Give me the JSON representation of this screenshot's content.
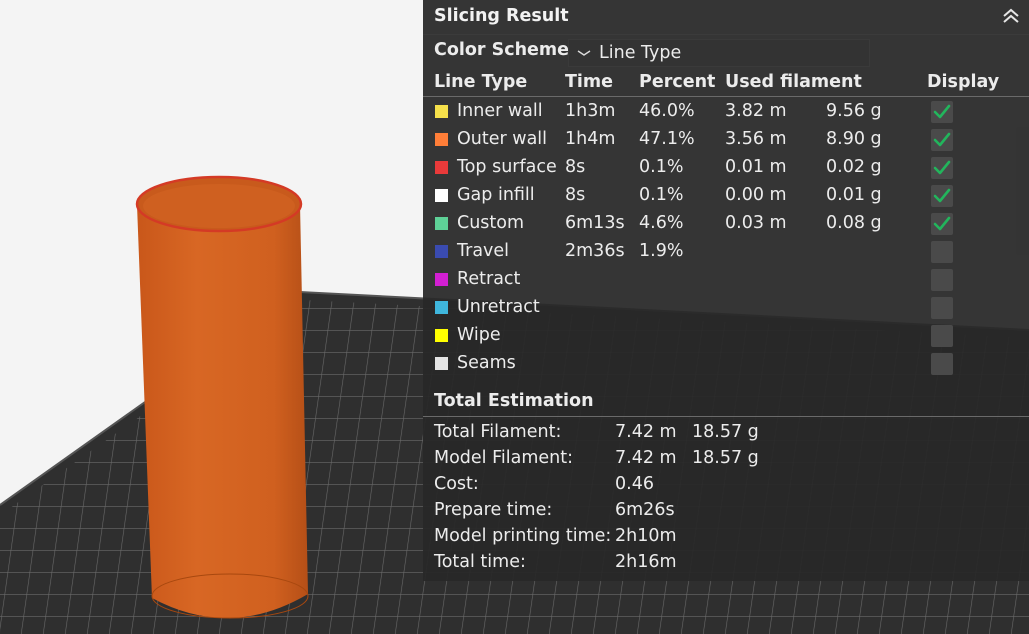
{
  "panel": {
    "title": "Slicing Result",
    "color_scheme_label": "Color Scheme",
    "color_scheme_value": "Line Type",
    "headers": {
      "line_type": "Line Type",
      "time": "Time",
      "percent": "Percent",
      "used_filament": "Used filament",
      "display": "Display"
    },
    "rows": [
      {
        "name": "Inner wall",
        "color": "#f6e14b",
        "time": "1h3m",
        "percent": "46.0%",
        "length": "3.82 m",
        "weight": "9.56 g",
        "display": true
      },
      {
        "name": "Outer wall",
        "color": "#ff7e38",
        "time": "1h4m",
        "percent": "47.1%",
        "length": "3.56 m",
        "weight": "8.90 g",
        "display": true
      },
      {
        "name": "Top surface",
        "color": "#e93a3a",
        "time": "8s",
        "percent": "0.1%",
        "length": "0.01 m",
        "weight": "0.02 g",
        "display": true
      },
      {
        "name": "Gap infill",
        "color": "#ffffff",
        "time": "8s",
        "percent": "0.1%",
        "length": "0.00 m",
        "weight": "0.01 g",
        "display": true
      },
      {
        "name": "Custom",
        "color": "#5ed197",
        "time": "6m13s",
        "percent": "4.6%",
        "length": "0.03 m",
        "weight": "0.08 g",
        "display": true
      },
      {
        "name": "Travel",
        "color": "#3a4bb0",
        "time": "2m36s",
        "percent": "1.9%",
        "length": "",
        "weight": "",
        "display": false
      },
      {
        "name": "Retract",
        "color": "#d21fd2",
        "time": "",
        "percent": "",
        "length": "",
        "weight": "",
        "display": false
      },
      {
        "name": "Unretract",
        "color": "#3fb6dc",
        "time": "",
        "percent": "",
        "length": "",
        "weight": "",
        "display": false
      },
      {
        "name": "Wipe",
        "color": "#ffff00",
        "time": "",
        "percent": "",
        "length": "",
        "weight": "",
        "display": false
      },
      {
        "name": "Seams",
        "color": "#e4e4e4",
        "time": "",
        "percent": "",
        "length": "",
        "weight": "",
        "display": false
      }
    ],
    "total_estimation": {
      "title": "Total Estimation",
      "rows": [
        {
          "label": "Total Filament:",
          "value": "7.42 m",
          "extra": "18.57 g"
        },
        {
          "label": "Model Filament:",
          "value": "7.42 m",
          "extra": "18.57 g"
        },
        {
          "label": "Cost:",
          "value": "0.46",
          "extra": ""
        },
        {
          "label": "Prepare time:",
          "value": "6m26s",
          "extra": ""
        },
        {
          "label": "Model printing time:",
          "value": "2h10m",
          "extra": ""
        },
        {
          "label": "Total time:",
          "value": "2h16m",
          "extra": ""
        }
      ]
    }
  },
  "colors": {
    "check_green": "#22b55c",
    "model_orange": "#d2601c",
    "plate_dark": "#3a3a3a"
  }
}
